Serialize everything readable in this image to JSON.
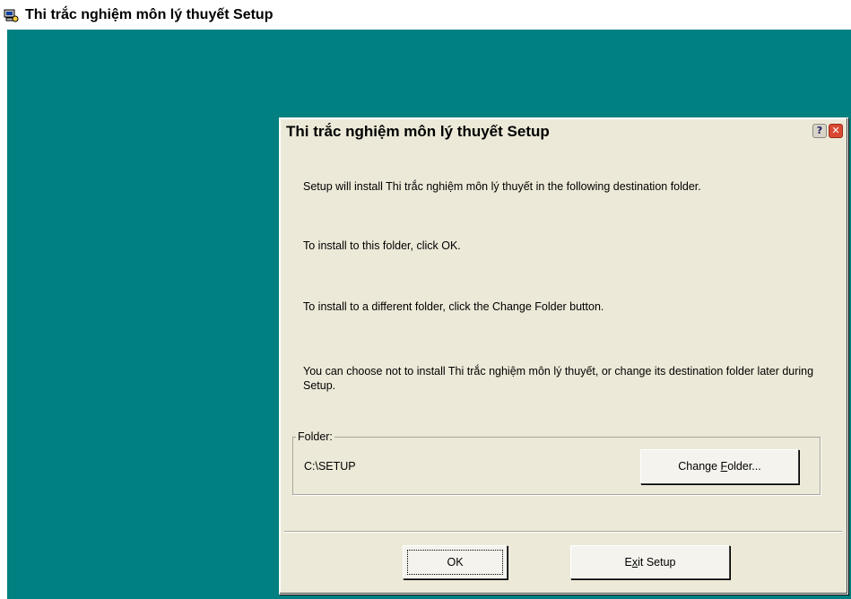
{
  "window": {
    "title": "Thi trắc nghiệm môn lý thuyết Setup"
  },
  "dialog": {
    "title": "Thi trắc nghiệm môn lý thuyết Setup",
    "help_label": "?",
    "close_label": "✕",
    "messages": [
      "Setup will install Thi trắc nghiệm môn lý thuyết in the following destination folder.",
      "To install to this folder, click OK.",
      "To install to a different folder, click the Change Folder button.",
      "You can choose not to install Thi trắc nghiệm môn lý thuyết, or change its destination folder later during Setup."
    ],
    "folder": {
      "label": "Folder:",
      "path": "C:\\SETUP",
      "change_button": {
        "before": "Change ",
        "mnemonic": "F",
        "after": "older..."
      }
    },
    "ok_button": "OK",
    "exit_button": {
      "before": "E",
      "mnemonic": "x",
      "after": "it Setup"
    }
  },
  "colors": {
    "desktop": "#008080",
    "dialog_face": "#ece9d8"
  },
  "icons": {
    "app": "setup-computer-icon",
    "help": "help-icon",
    "close": "close-icon"
  }
}
